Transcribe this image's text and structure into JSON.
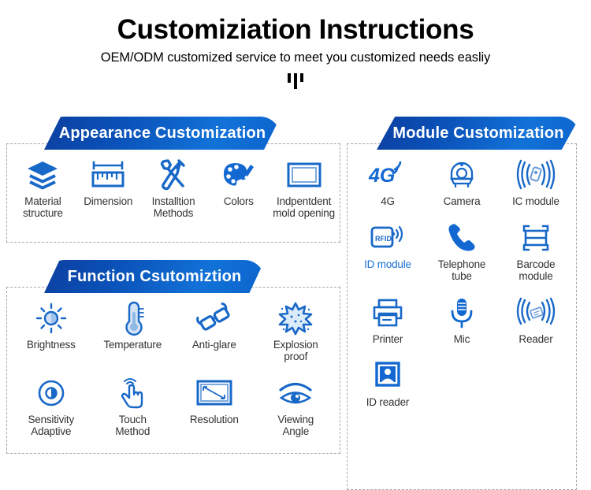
{
  "header": {
    "title": "Customiziation Instructions",
    "subtitle": "OEM/ODM customized service to meet you customized needs easliy",
    "divider_bars": 3
  },
  "colors": {
    "brand_blue": "#0b63cc",
    "brand_blue_dark": "#0d3fa0",
    "icon_blue": "#1868c8",
    "caption_gray": "#333333",
    "accent_caption": "#1a6fd4",
    "dashed_border": "#a6a6a6"
  },
  "sections": {
    "appearance": {
      "title": "Appearance Customization",
      "items": [
        {
          "label": "Material\nstructure",
          "icon": "layers-icon"
        },
        {
          "label": "Dimension",
          "icon": "ruler-icon"
        },
        {
          "label": "Installtion\nMethods",
          "icon": "tools-icon"
        },
        {
          "label": "Colors",
          "icon": "palette-icon"
        },
        {
          "label": "Indpentdent\nmold opening",
          "icon": "mold-frame-icon"
        }
      ]
    },
    "function": {
      "title": "Function Csutomiztion",
      "items": [
        {
          "label": "Brightness",
          "icon": "brightness-icon"
        },
        {
          "label": "Temperature",
          "icon": "thermometer-icon"
        },
        {
          "label": "Anti-glare",
          "icon": "sunglasses-icon"
        },
        {
          "label": "Explosion\nproof",
          "icon": "explosion-icon"
        },
        {
          "label": "Sensitivity\nAdaptive",
          "icon": "sensitivity-icon"
        },
        {
          "label": "Touch\nMethod",
          "icon": "touch-hand-icon"
        },
        {
          "label": "Resolution",
          "icon": "resolution-icon"
        },
        {
          "label": "Viewing\nAngle",
          "icon": "eye-icon"
        }
      ]
    },
    "module": {
      "title": "Module Customization",
      "items": [
        {
          "label": "4G",
          "icon": "4g-signal-icon",
          "accent": false
        },
        {
          "label": "Camera",
          "icon": "camera-icon",
          "accent": false
        },
        {
          "label": "IC module",
          "icon": "ic-module-icon",
          "accent": false
        },
        {
          "label": "ID module",
          "icon": "rfid-card-icon",
          "accent": true
        },
        {
          "label": "Telephone\ntube",
          "icon": "telephone-handset-icon",
          "accent": false
        },
        {
          "label": "Barcode\nmodule",
          "icon": "barcode-scan-icon",
          "accent": false
        },
        {
          "label": "Printer",
          "icon": "printer-icon",
          "accent": false
        },
        {
          "label": "Mic",
          "icon": "microphone-icon",
          "accent": false
        },
        {
          "label": "Reader",
          "icon": "card-reader-icon",
          "accent": false
        },
        {
          "label": "ID reader",
          "icon": "id-photo-icon",
          "accent": false
        }
      ]
    }
  }
}
